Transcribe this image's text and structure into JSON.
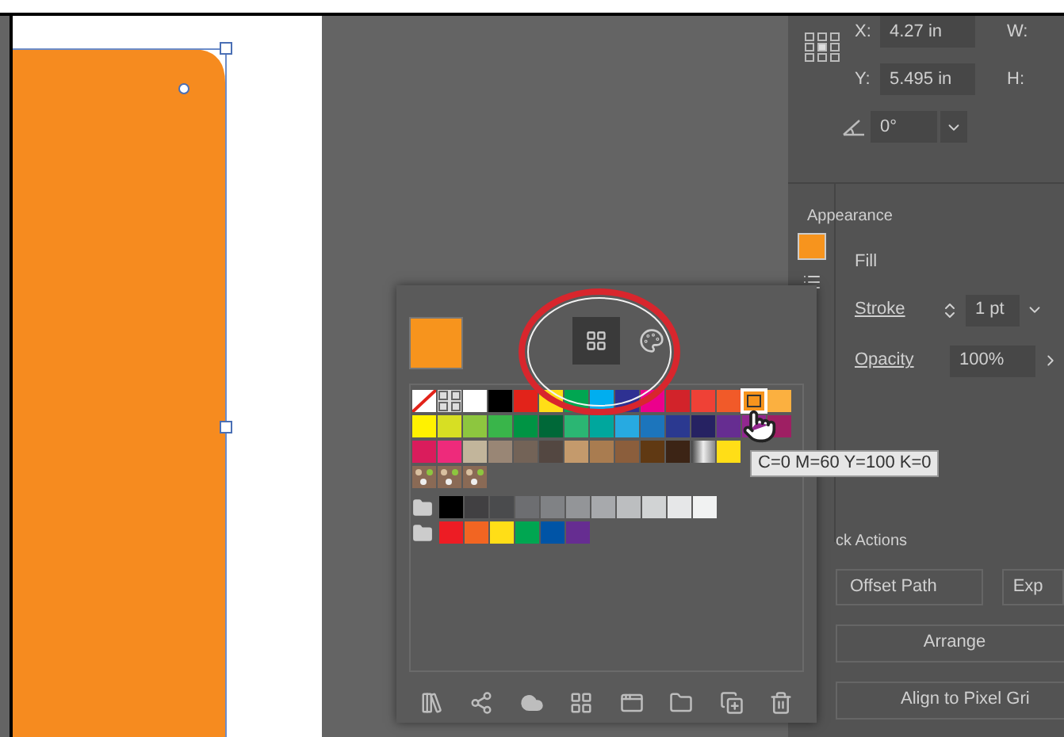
{
  "transform": {
    "x_label": "X:",
    "x_value": "4.27 in",
    "w_label": "W:",
    "y_label": "Y:",
    "y_value": "5.495 in",
    "h_label": "H:",
    "angle_value": "0°"
  },
  "appearance": {
    "title": "Appearance",
    "fill_label": "Fill",
    "stroke_label": "Stroke",
    "stroke_value": "1 pt",
    "opacity_label": "Opacity",
    "opacity_value": "100%"
  },
  "quick_actions": {
    "title": "ck Actions",
    "buttons": [
      "Offset Path",
      "Exp",
      "Arrange",
      "Align to Pixel Gri"
    ]
  },
  "swatches_panel": {
    "views": [
      {
        "kind": "swatches",
        "selected": true
      },
      {
        "kind": "color-guide",
        "selected": false
      }
    ],
    "swatch_rows": [
      {
        "folder": false,
        "swatches": [
          {
            "kind": "none",
            "selected": false
          },
          {
            "kind": "registration",
            "selected": false
          },
          {
            "kind": "color",
            "color": "#ffffff",
            "selected": false
          },
          {
            "kind": "color",
            "color": "#000000",
            "selected": false
          },
          {
            "kind": "color",
            "color": "#e2231a",
            "selected": false
          },
          {
            "kind": "color",
            "color": "#ffde17",
            "selected": false
          },
          {
            "kind": "color",
            "color": "#00a651",
            "selected": false
          },
          {
            "kind": "color",
            "color": "#00aeef",
            "selected": false
          },
          {
            "kind": "color",
            "color": "#2e3192",
            "selected": false
          },
          {
            "kind": "color",
            "color": "#ec008c",
            "selected": false
          },
          {
            "kind": "color",
            "color": "#d2232a",
            "selected": false
          },
          {
            "kind": "color",
            "color": "#ef4136",
            "selected": false
          },
          {
            "kind": "color",
            "color": "#f15a29",
            "selected": false
          },
          {
            "kind": "color",
            "color": "#f7941d",
            "selected": true
          },
          {
            "kind": "color",
            "color": "#fbb040",
            "selected": false
          }
        ]
      },
      {
        "folder": false,
        "swatches": [
          {
            "kind": "color",
            "color": "#fff200",
            "selected": false
          },
          {
            "kind": "color",
            "color": "#d7df23",
            "selected": false
          },
          {
            "kind": "color",
            "color": "#8dc63f",
            "selected": false
          },
          {
            "kind": "color",
            "color": "#39b54a",
            "selected": false
          },
          {
            "kind": "color",
            "color": "#009444",
            "selected": false
          },
          {
            "kind": "color",
            "color": "#006838",
            "selected": false
          },
          {
            "kind": "color",
            "color": "#2bb673",
            "selected": false
          },
          {
            "kind": "color",
            "color": "#00a79d",
            "selected": false
          },
          {
            "kind": "color",
            "color": "#27aae1",
            "selected": false
          },
          {
            "kind": "color",
            "color": "#1c75bc",
            "selected": false
          },
          {
            "kind": "color",
            "color": "#2b3990",
            "selected": false
          },
          {
            "kind": "color",
            "color": "#262262",
            "selected": false
          },
          {
            "kind": "color",
            "color": "#662d91",
            "selected": false
          },
          {
            "kind": "color",
            "color": "#92278f",
            "selected": false
          },
          {
            "kind": "color",
            "color": "#9e1f63",
            "selected": false
          }
        ]
      },
      {
        "folder": false,
        "swatches": [
          {
            "kind": "color",
            "color": "#da1c5c",
            "selected": false
          },
          {
            "kind": "color",
            "color": "#ee2a7b",
            "selected": false
          },
          {
            "kind": "color",
            "color": "#c2b59b",
            "selected": false
          },
          {
            "kind": "color",
            "color": "#998675",
            "selected": false
          },
          {
            "kind": "color",
            "color": "#736357",
            "selected": false
          },
          {
            "kind": "color",
            "color": "#534741",
            "selected": false
          },
          {
            "kind": "color",
            "color": "#c49a6c",
            "selected": false
          },
          {
            "kind": "color",
            "color": "#a97c50",
            "selected": false
          },
          {
            "kind": "color",
            "color": "#8b5e3c",
            "selected": false
          },
          {
            "kind": "color",
            "color": "#603913",
            "selected": false
          },
          {
            "kind": "color",
            "color": "#3c2415",
            "selected": false
          },
          {
            "kind": "gradient",
            "selected": false
          },
          {
            "kind": "color",
            "color": "#ffde17",
            "selected": false
          }
        ]
      },
      {
        "folder": false,
        "swatches": [
          {
            "kind": "pattern",
            "selected": false
          },
          {
            "kind": "pattern",
            "selected": false
          },
          {
            "kind": "pattern",
            "selected": false
          }
        ]
      },
      {
        "folder": true,
        "swatches": [
          {
            "kind": "color",
            "color": "#000000",
            "selected": false
          },
          {
            "kind": "color",
            "color": "#414042",
            "selected": false
          },
          {
            "kind": "color",
            "color": "#4a4b4d",
            "selected": false
          },
          {
            "kind": "color",
            "color": "#6d6e71",
            "selected": false
          },
          {
            "kind": "color",
            "color": "#808285",
            "selected": false
          },
          {
            "kind": "color",
            "color": "#939598",
            "selected": false
          },
          {
            "kind": "color",
            "color": "#a7a9ac",
            "selected": false
          },
          {
            "kind": "color",
            "color": "#bcbec0",
            "selected": false
          },
          {
            "kind": "color",
            "color": "#d1d3d4",
            "selected": false
          },
          {
            "kind": "color",
            "color": "#e6e7e8",
            "selected": false
          },
          {
            "kind": "color",
            "color": "#f1f2f2",
            "selected": false
          }
        ]
      },
      {
        "folder": true,
        "swatches": [
          {
            "kind": "color",
            "color": "#ed1c24",
            "selected": false
          },
          {
            "kind": "color",
            "color": "#f26522",
            "selected": false
          },
          {
            "kind": "color",
            "color": "#ffde17",
            "selected": false
          },
          {
            "kind": "color",
            "color": "#00a651",
            "selected": false
          },
          {
            "kind": "color",
            "color": "#0054a6",
            "selected": false
          },
          {
            "kind": "color",
            "color": "#662d91",
            "selected": false
          }
        ]
      }
    ],
    "tooltip": "C=0 M=60 Y=100 K=0"
  }
}
